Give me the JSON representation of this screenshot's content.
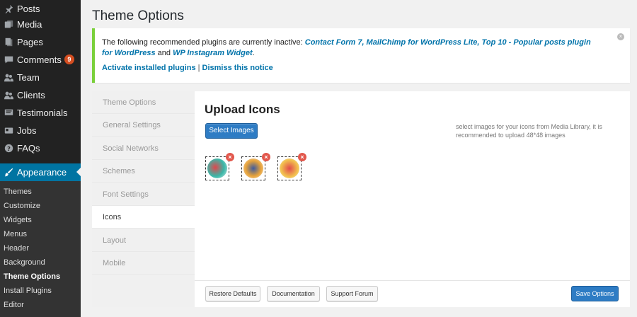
{
  "sidebar": {
    "items": [
      {
        "label": "Posts",
        "icon": "pin-icon"
      },
      {
        "label": "Media",
        "icon": "media-icon"
      },
      {
        "label": "Pages",
        "icon": "pages-icon"
      },
      {
        "label": "Comments",
        "icon": "comments-icon",
        "badge": "9"
      },
      {
        "label": "Team",
        "icon": "team-icon"
      },
      {
        "label": "Clients",
        "icon": "clients-icon"
      },
      {
        "label": "Testimonials",
        "icon": "testimonials-icon"
      },
      {
        "label": "Jobs",
        "icon": "jobs-icon"
      },
      {
        "label": "FAQs",
        "icon": "faqs-icon"
      }
    ],
    "active": {
      "label": "Appearance",
      "icon": "brush-icon"
    },
    "submenu": [
      "Themes",
      "Customize",
      "Widgets",
      "Menus",
      "Header",
      "Background",
      "Theme Options",
      "Install Plugins",
      "Editor"
    ],
    "submenu_current": "Theme Options"
  },
  "page": {
    "title": "Theme Options"
  },
  "notice": {
    "text_before": "The following recommended plugins are currently inactive: ",
    "plugins": "Contact Form 7, MailChimp for WordPress Lite, Top 10 - Popular posts plugin for WordPress",
    "and": " and ",
    "plugin_last": "WP Instagram Widget",
    "period": ".",
    "activate_link": "Activate installed plugins",
    "separator": "|",
    "dismiss_link": "Dismiss this notice",
    "close_glyph": "×"
  },
  "options_nav": {
    "items": [
      "Theme Options",
      "General Settings",
      "Social Networks",
      "Schemes",
      "Font Settings",
      "Icons",
      "Layout",
      "Mobile"
    ],
    "active": "Icons"
  },
  "upload": {
    "title": "Upload Icons",
    "select_button": "Select Images",
    "hint": "select images for your icons from Media Library, it is recommended to upload 48*48 images",
    "delete_glyph": "×",
    "thumbs": [
      {
        "colors": [
          "#e0474c",
          "#3ab7a8"
        ]
      },
      {
        "colors": [
          "#3e5a9e",
          "#e8a33a"
        ]
      },
      {
        "colors": [
          "#e24b4b",
          "#f2c14e"
        ]
      }
    ]
  },
  "footer": {
    "restore": "Restore Defaults",
    "documentation": "Documentation",
    "support": "Support Forum",
    "save": "Save Options"
  },
  "colors": {
    "accent": "#0074a2",
    "sidebar": "#222222",
    "notice_border": "#7ad03a",
    "button": "#2e7cc4",
    "badge": "#d54e21"
  }
}
